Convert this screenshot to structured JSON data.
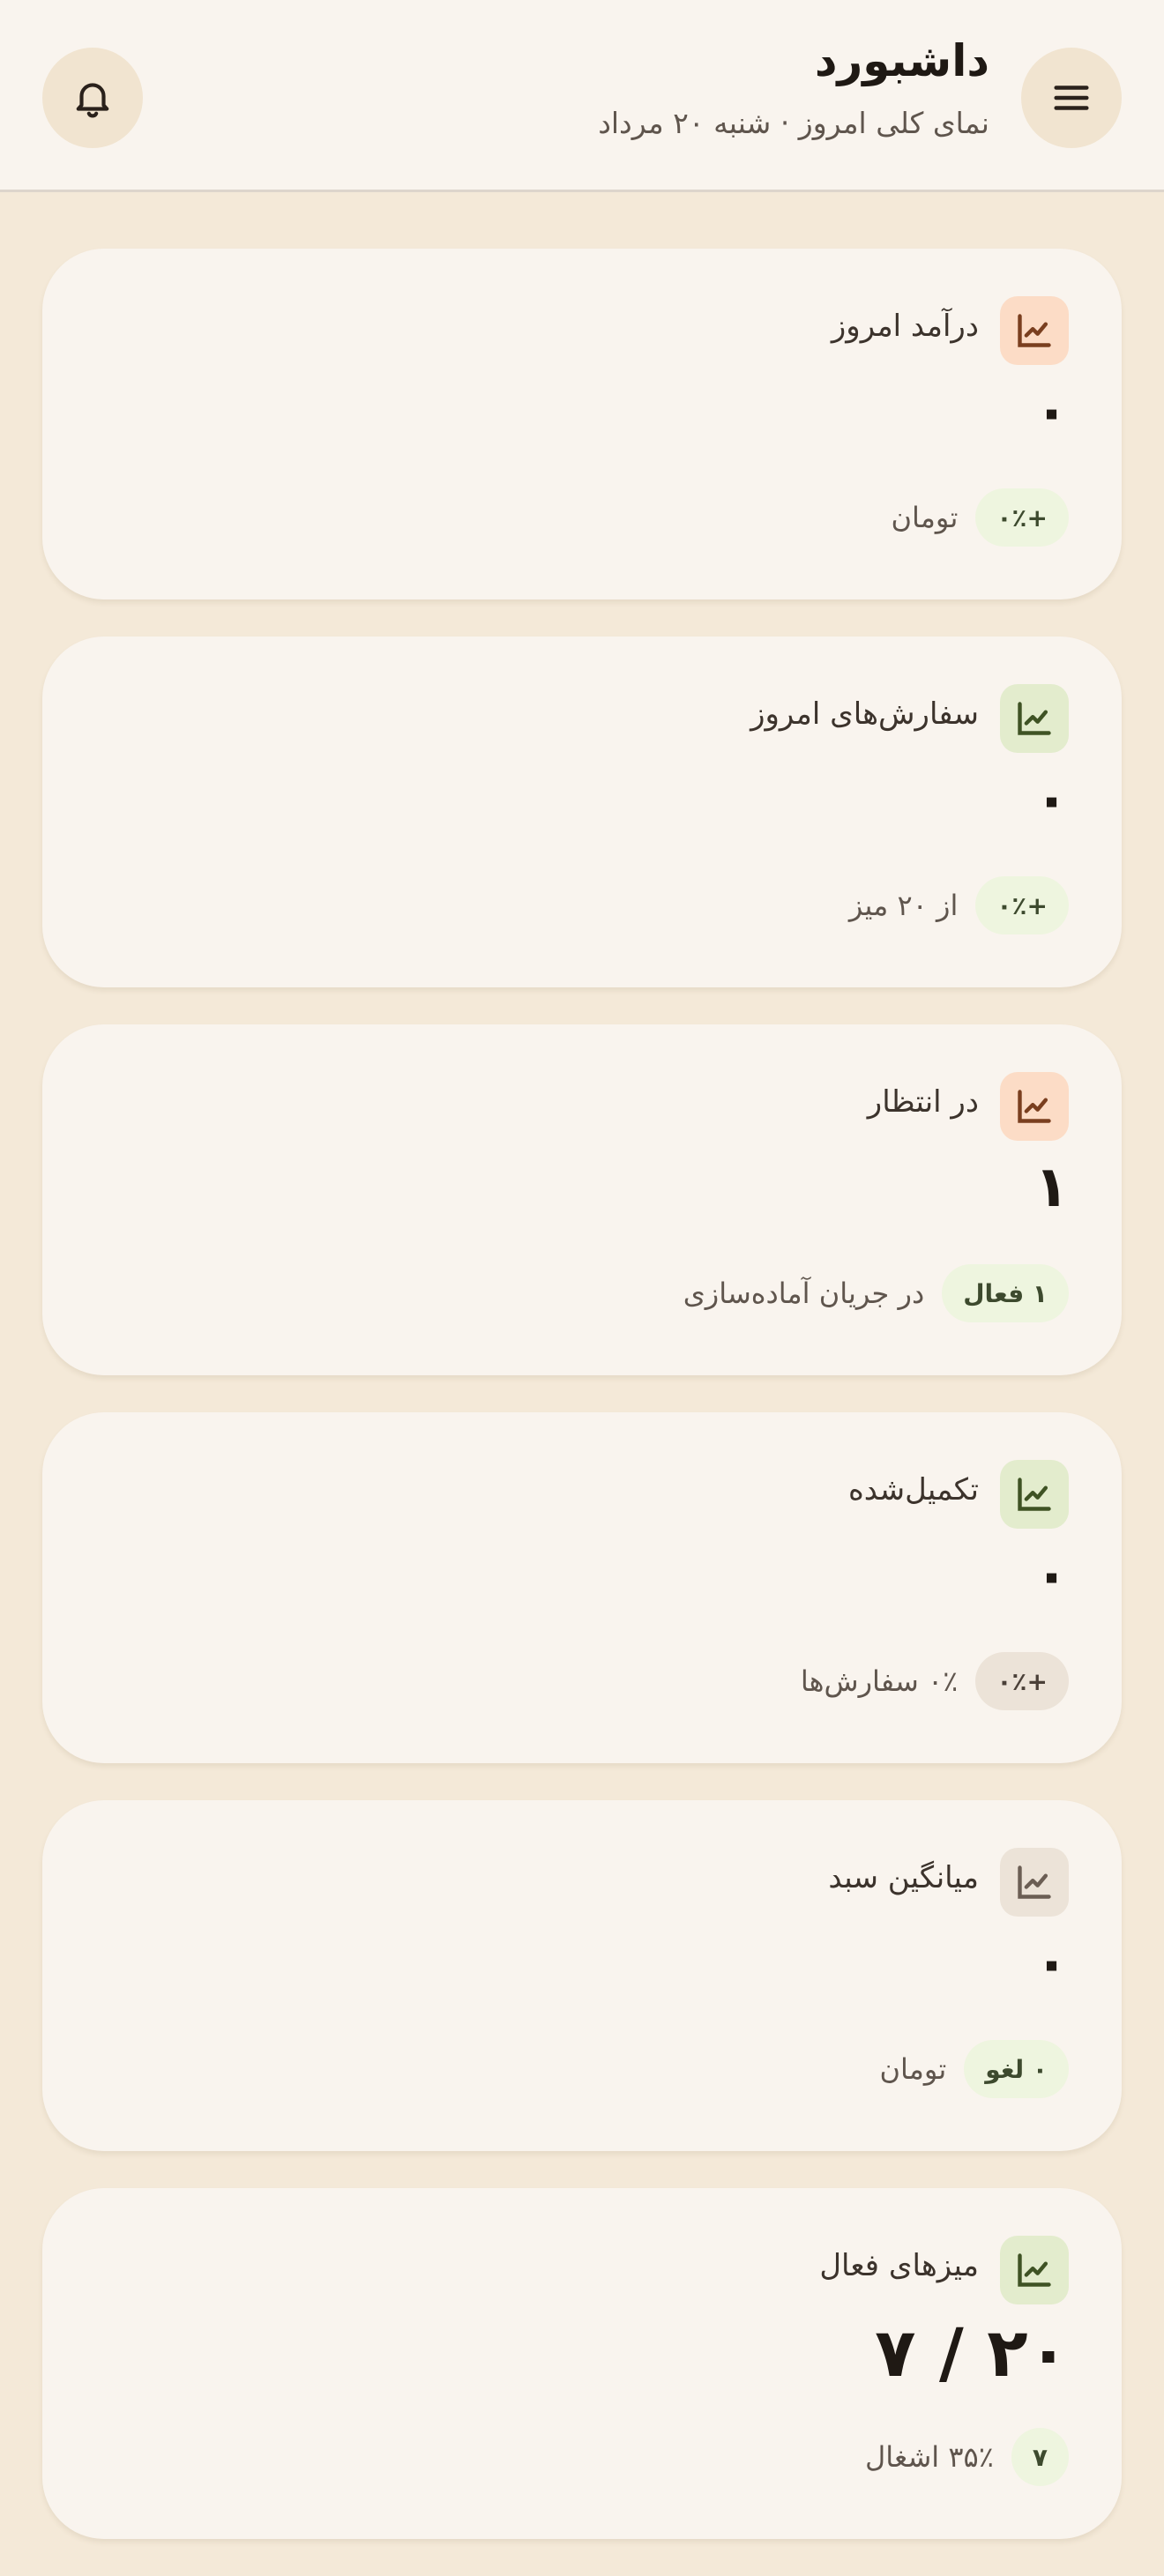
{
  "colors": {
    "background": "#f4e9d8",
    "surface": "#f9f4ee",
    "icon_orange": "#fcdcc6",
    "icon_green": "#e3eccd",
    "icon_grey": "#ece3d8",
    "accent_brown": "#7a3f1f",
    "accent_olive": "#3f5324"
  },
  "header": {
    "title": "داشبورد",
    "subtitle": "نمای کلی امروز · شنبه ۲۰ مرداد",
    "menu_icon": "hamburger-menu-icon",
    "bell_icon": "bell-icon"
  },
  "cards": [
    {
      "label": "درآمد امروز",
      "value": "۰",
      "badge": "+۰٪",
      "note": "تومان",
      "icon": "line-chart-icon"
    },
    {
      "label": "سفارش‌های امروز",
      "value": "۰",
      "badge": "+۰٪",
      "note": "از ۲۰ میز",
      "icon": "line-chart-icon"
    },
    {
      "label": "در انتظار",
      "value": "۱",
      "badge": "۱ فعال",
      "note": "در جریان آماده‌سازی",
      "icon": "line-chart-icon"
    },
    {
      "label": "تکمیل‌شده",
      "value": "۰",
      "badge": "+۰٪",
      "note": "۰٪ سفارش‌ها",
      "icon": "line-chart-icon"
    },
    {
      "label": "میانگین سبد",
      "value": "۰",
      "badge": "۰ لغو",
      "note": "تومان",
      "icon": "line-chart-icon"
    },
    {
      "label": "میزهای فعال",
      "value": "۲۰ / ۷",
      "badge": "۷",
      "note": "۳۵٪ اشغال",
      "icon": "line-chart-icon"
    }
  ]
}
